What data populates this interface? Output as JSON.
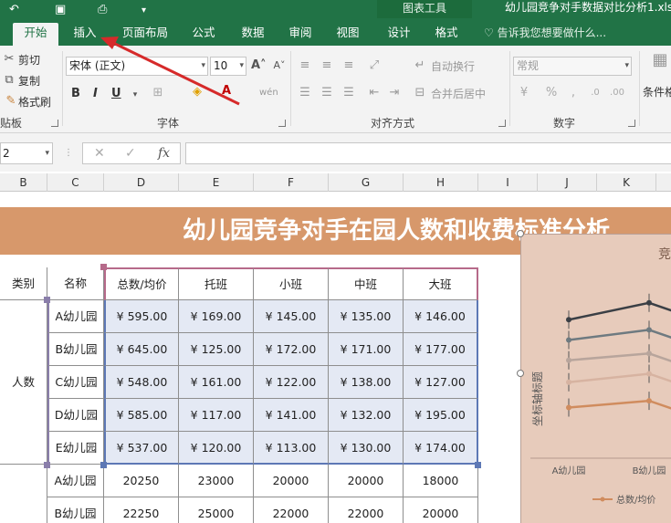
{
  "app": {
    "chart_tools_label": "图表工具",
    "file_title": "幼儿园竞争对手数据对比分析1.xlsx"
  },
  "tabs": {
    "home": "开始",
    "insert": "插入",
    "page_layout": "页面布局",
    "formulas": "公式",
    "data": "数据",
    "review": "审阅",
    "view": "视图",
    "design": "设计",
    "format": "格式",
    "tell_me": "告诉我您想要做什么..."
  },
  "ribbon": {
    "cut": "剪切",
    "copy": "复制",
    "format_painter": "格式刷",
    "clipboard_group": "贴板",
    "font_name": "宋体 (正文)",
    "font_size": "10",
    "bold": "B",
    "italic": "I",
    "underline": "U",
    "font_group": "字体",
    "wrap_text": "自动换行",
    "merge_center": "合并后居中",
    "alignment_group": "对齐方式",
    "number_format": "常规",
    "number_group": "数字",
    "conditional_format": "条件格"
  },
  "formula_bar": {
    "name_box": "2",
    "fx": "fx"
  },
  "columns": [
    "B",
    "C",
    "D",
    "E",
    "F",
    "G",
    "H",
    "I",
    "J",
    "K"
  ],
  "sheet": {
    "title": "幼儿园竞争对手在园人数和收费标准分析",
    "headers": [
      "类别",
      "名称",
      "总数/均价",
      "托班",
      "小班",
      "中班",
      "大班"
    ],
    "category_label": "人数",
    "money_rows": [
      {
        "name": "A幼儿园",
        "values": [
          "¥ 595.00",
          "¥ 169.00",
          "¥ 145.00",
          "¥ 135.00",
          "¥ 146.00"
        ]
      },
      {
        "name": "B幼儿园",
        "values": [
          "¥ 645.00",
          "¥ 125.00",
          "¥ 172.00",
          "¥ 171.00",
          "¥ 177.00"
        ]
      },
      {
        "name": "C幼儿园",
        "values": [
          "¥ 548.00",
          "¥ 161.00",
          "¥ 122.00",
          "¥ 138.00",
          "¥ 127.00"
        ]
      },
      {
        "name": "D幼儿园",
        "values": [
          "¥ 585.00",
          "¥ 117.00",
          "¥ 141.00",
          "¥ 132.00",
          "¥ 195.00"
        ]
      },
      {
        "name": "E幼儿园",
        "values": [
          "¥ 537.00",
          "¥ 120.00",
          "¥ 113.00",
          "¥ 130.00",
          "¥ 174.00"
        ]
      }
    ],
    "count_rows": [
      {
        "name": "A幼儿园",
        "values": [
          "20250",
          "23000",
          "20000",
          "20000",
          "18000"
        ]
      },
      {
        "name": "B幼儿园",
        "values": [
          "22250",
          "25000",
          "22000",
          "22000",
          "20000"
        ]
      }
    ]
  },
  "chart": {
    "title_fragment": "竞",
    "y_axis_title": "坐标轴标题",
    "legend": "总数/均价",
    "colors": [
      "#3a3f45",
      "#6e7a80",
      "#b8a59c",
      "#d7b3a1",
      "#d08c5e"
    ]
  },
  "chart_data": {
    "type": "line",
    "categories": [
      "A幼儿园",
      "B幼儿园"
    ],
    "series": [
      {
        "name": "总数/均价",
        "values": [
          0.82,
          0.92
        ]
      },
      {
        "values": [
          0.7,
          0.76
        ]
      },
      {
        "values": [
          0.58,
          0.62
        ]
      },
      {
        "values": [
          0.45,
          0.5
        ]
      },
      {
        "values": [
          0.3,
          0.34
        ]
      }
    ]
  }
}
